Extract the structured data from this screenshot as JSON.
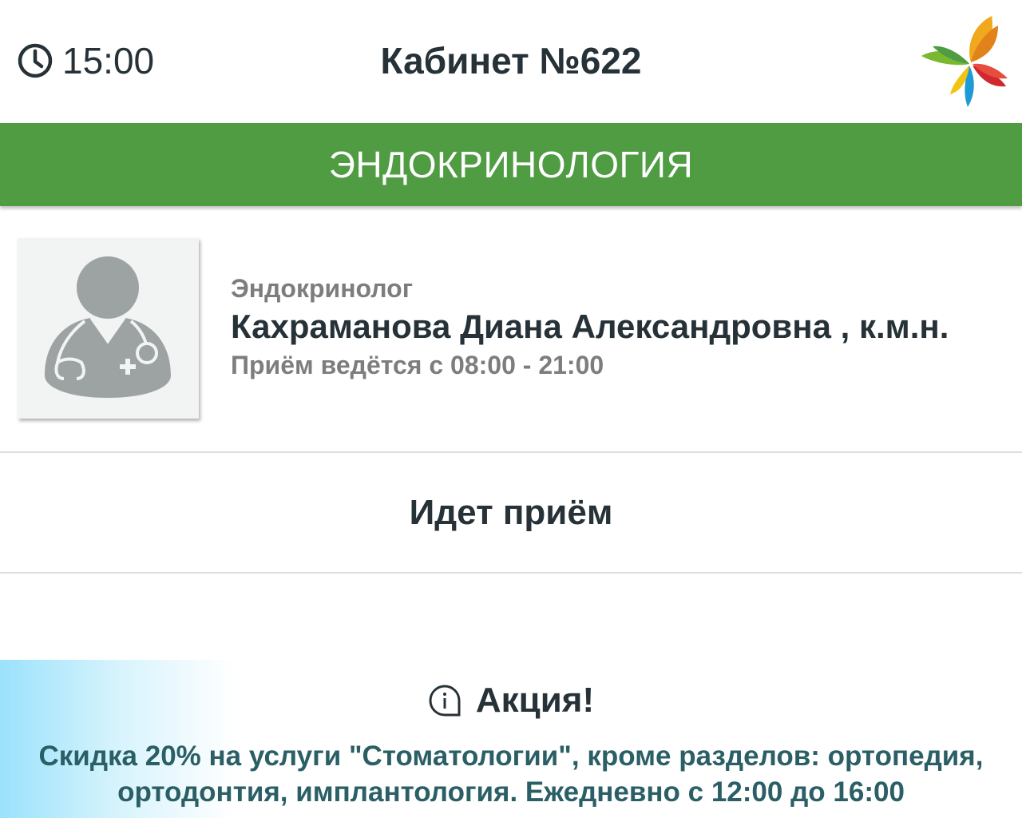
{
  "header": {
    "time": "15:00",
    "room_title": "Кабинет №622",
    "clock_icon": "clock-icon",
    "logo_icon": "butterfly-logo-icon"
  },
  "department": {
    "name": "ЭНДОКРИНОЛОГИЯ",
    "color": "#4f9c43"
  },
  "doctor": {
    "photo_icon": "doctor-avatar-icon",
    "specialty": "Эндокринолог",
    "name": "Кахраманова Диана Александровна , к.м.н.",
    "hours": "Приём ведётся с 08:00 - 21:00"
  },
  "status": {
    "text": "Идет приём"
  },
  "promo": {
    "icon": "info-bubble-icon",
    "title": "Акция!",
    "text": "Скидка 20% на услуги \"Стоматологии\", кроме разделов: ортопедия, ортодонтия, имплантология. Ежедневно с 12:00 до 16:00"
  }
}
